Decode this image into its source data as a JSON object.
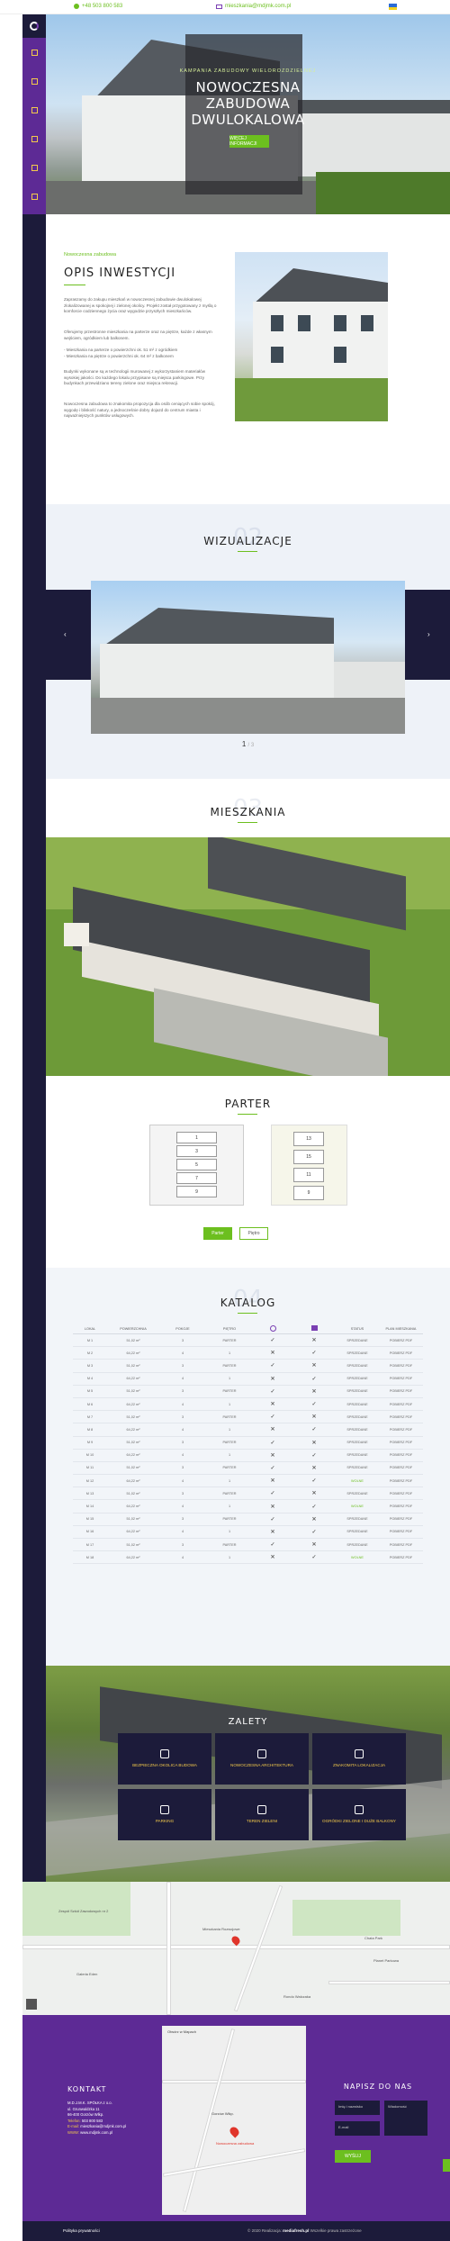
{
  "topbar": {
    "phone": "+48 503 800 583",
    "email": "mieszkania@mdjmk.com.pl",
    "phone_icon": "phone-icon",
    "email_icon": "envelope-icon",
    "language_flag": "ukraine-flag",
    "accent_color": "#6cbf1f"
  },
  "sidebar": {
    "logo": "logo",
    "items": [
      {
        "icon": "home-icon"
      },
      {
        "icon": "building-icon"
      },
      {
        "icon": "visualization-icon"
      },
      {
        "icon": "floorplan-icon"
      },
      {
        "icon": "catalog-icon"
      },
      {
        "icon": "location-icon"
      },
      {
        "icon": "contact-icon"
      }
    ],
    "bg_color": "#5d2a95",
    "rail_color": "#1c1b3a"
  },
  "hero": {
    "kicker": "KAMPANIA ZABUDOWY WIELOROZDZIELNEJ",
    "title": "NOWOCZESNA ZABUDOWA DWULOKALOWA",
    "button": "WIĘCEJ INFORMACJI"
  },
  "opis": {
    "kicker": "Nowoczesna zabudowa",
    "title": "OPIS INWESTYCJI",
    "paragraphs": [
      "Zapraszamy do zakupu mieszkań w nowoczesnej zabudowie dwulokalowej zlokalizowanej w spokojnej i zielonej okolicy. Projekt został przygotowany z myślą o komforcie codziennego życia oraz wygodzie przyszłych mieszkańców.",
      "Oferujemy przestronne mieszkania na parterze oraz na piętrze, każde z własnym wejściem, ogródkiem lub balkonem.",
      "- Mieszkania na parterze o powierzchni ok. 51 m² z ogródkiem\n- Mieszkania na piętrze o powierzchni ok. 64 m² z balkonem",
      "Budynki wykonane są w technologii murowanej z wykorzystaniem materiałów wysokiej jakości. Do każdego lokalu przypisane są miejsca parkingowe. Przy budynkach przewidziano tereny zielone oraz miejsca rekreacji.",
      "Nowoczesna zabudowa to znakomita propozycja dla osób ceniących sobie spokój, wygodę i bliskość natury, a jednocześnie dobry dojazd do centrum miasta i najważniejszych punktów usługowych."
    ]
  },
  "wizualizacje": {
    "bg_number": "02",
    "title": "WIZUALIZACJE",
    "prev": "‹",
    "next": "›",
    "page": "1",
    "page_sep": "/ 3"
  },
  "mieszkania": {
    "bg_number": "03",
    "title": "MIESZKANIA"
  },
  "parter": {
    "title": "PARTER",
    "units_left": [
      "1",
      "3",
      "5",
      "7",
      "9"
    ],
    "units_right": [
      "13",
      "15",
      "11",
      "9"
    ],
    "unit_a": "A",
    "unit_b": "B",
    "btn_parter": "Parter",
    "btn_pietro": "Piętro"
  },
  "katalog": {
    "bg_number": "04",
    "title": "KATALOG",
    "headers": [
      "LOKAL",
      "POWIERZCHNIA",
      "POKOJE",
      "PIĘTRO",
      "OGRÓD",
      "BALKON",
      "STATUS",
      "PLAN MIESZKANIA"
    ],
    "header_icons": [
      "garden-icon",
      "balcony-icon"
    ],
    "rows": [
      {
        "lokal": "M 1",
        "pow": "51,02 m²",
        "pokoje": "3",
        "pietro": "PARTER",
        "ogrod": true,
        "balkon": false,
        "status": "SPRZEDANE",
        "plan": "POBIERZ PDF"
      },
      {
        "lokal": "M 2",
        "pow": "64,22 m²",
        "pokoje": "4",
        "pietro": "1",
        "ogrod": false,
        "balkon": true,
        "status": "SPRZEDANE",
        "plan": "POBIERZ PDF"
      },
      {
        "lokal": "M 3",
        "pow": "51,02 m²",
        "pokoje": "3",
        "pietro": "PARTER",
        "ogrod": true,
        "balkon": false,
        "status": "SPRZEDANE",
        "plan": "POBIERZ PDF"
      },
      {
        "lokal": "M 4",
        "pow": "64,22 m²",
        "pokoje": "4",
        "pietro": "1",
        "ogrod": false,
        "balkon": true,
        "status": "SPRZEDANE",
        "plan": "POBIERZ PDF"
      },
      {
        "lokal": "M 5",
        "pow": "51,02 m²",
        "pokoje": "3",
        "pietro": "PARTER",
        "ogrod": true,
        "balkon": false,
        "status": "SPRZEDANE",
        "plan": "POBIERZ PDF"
      },
      {
        "lokal": "M 6",
        "pow": "64,22 m²",
        "pokoje": "4",
        "pietro": "1",
        "ogrod": false,
        "balkon": true,
        "status": "SPRZEDANE",
        "plan": "POBIERZ PDF"
      },
      {
        "lokal": "M 7",
        "pow": "51,02 m²",
        "pokoje": "3",
        "pietro": "PARTER",
        "ogrod": true,
        "balkon": false,
        "status": "SPRZEDANE",
        "plan": "POBIERZ PDF"
      },
      {
        "lokal": "M 8",
        "pow": "64,22 m²",
        "pokoje": "4",
        "pietro": "1",
        "ogrod": false,
        "balkon": true,
        "status": "SPRZEDANE",
        "plan": "POBIERZ PDF"
      },
      {
        "lokal": "M 9",
        "pow": "51,02 m²",
        "pokoje": "3",
        "pietro": "PARTER",
        "ogrod": true,
        "balkon": false,
        "status": "SPRZEDANE",
        "plan": "POBIERZ PDF"
      },
      {
        "lokal": "M 10",
        "pow": "64,22 m²",
        "pokoje": "4",
        "pietro": "1",
        "ogrod": false,
        "balkon": true,
        "status": "SPRZEDANE",
        "plan": "POBIERZ PDF"
      },
      {
        "lokal": "M 11",
        "pow": "51,02 m²",
        "pokoje": "3",
        "pietro": "PARTER",
        "ogrod": true,
        "balkon": false,
        "status": "SPRZEDANE",
        "plan": "POBIERZ PDF"
      },
      {
        "lokal": "M 12",
        "pow": "64,22 m²",
        "pokoje": "4",
        "pietro": "1",
        "ogrod": false,
        "balkon": true,
        "status": "WOLNE",
        "plan": "POBIERZ PDF"
      },
      {
        "lokal": "M 13",
        "pow": "51,02 m²",
        "pokoje": "3",
        "pietro": "PARTER",
        "ogrod": true,
        "balkon": false,
        "status": "SPRZEDANE",
        "plan": "POBIERZ PDF"
      },
      {
        "lokal": "M 14",
        "pow": "64,22 m²",
        "pokoje": "4",
        "pietro": "1",
        "ogrod": false,
        "balkon": true,
        "status": "WOLNE",
        "plan": "POBIERZ PDF"
      },
      {
        "lokal": "M 15",
        "pow": "51,02 m²",
        "pokoje": "3",
        "pietro": "PARTER",
        "ogrod": true,
        "balkon": false,
        "status": "SPRZEDANE",
        "plan": "POBIERZ PDF"
      },
      {
        "lokal": "M 16",
        "pow": "64,22 m²",
        "pokoje": "4",
        "pietro": "1",
        "ogrod": false,
        "balkon": true,
        "status": "SPRZEDANE",
        "plan": "POBIERZ PDF"
      },
      {
        "lokal": "M 17",
        "pow": "51,02 m²",
        "pokoje": "3",
        "pietro": "PARTER",
        "ogrod": true,
        "balkon": false,
        "status": "SPRZEDANE",
        "plan": "POBIERZ PDF"
      },
      {
        "lokal": "M 18",
        "pow": "64,22 m²",
        "pokoje": "4",
        "pietro": "1",
        "ogrod": false,
        "balkon": true,
        "status": "WOLNE",
        "plan": "POBIERZ PDF"
      }
    ]
  },
  "zalety": {
    "title": "ZALETY",
    "tiles": [
      {
        "icon": "family-icon",
        "label": "BEZPIECZNA OKOLICA BUDOWA"
      },
      {
        "icon": "architecture-icon",
        "label": "NOWOCZESNA ARCHITEKTURA"
      },
      {
        "icon": "parking-icon",
        "label": "ZNAKOMITA LOKALIZACJA"
      },
      {
        "icon": "wallet-icon",
        "label": "PARKING"
      },
      {
        "icon": "garden-icon",
        "label": "TEREN ZIELENI"
      },
      {
        "icon": "tree-icon",
        "label": "OGRÓDKI ZIELONE I DUŻE BALKONY"
      }
    ]
  },
  "map": {
    "labels": [
      "Zespół Szkół Zawodowych nr 2",
      "Mieszkania Rozwojowe",
      "Chata Park",
      "Galeria Eden",
      "Rondo Walczaka",
      "Planet Parkowa"
    ]
  },
  "kontakt": {
    "title": "KONTAKT",
    "lines": [
      {
        "label": "",
        "value": "M.D.J.M.K. SPÓŁKA z o.o."
      },
      {
        "label": "",
        "value": "ul. Grunwaldzka 11"
      },
      {
        "label": "",
        "value": "66-400 Gorzów Wlkp."
      },
      {
        "label": "Telefon:",
        "value": "503 800 583"
      },
      {
        "label": "E-mail:",
        "value": "mieszkania@mdjmk.com.pl"
      },
      {
        "label": "WWW:",
        "value": "www.mdjmk.com.pl"
      }
    ],
    "map_labels": [
      "Otwórz w Mapach",
      "Gorzów Wlkp.",
      "Nowoczesna zabudowa"
    ],
    "form_title": "NAPISZ DO NAS",
    "form": {
      "name_placeholder": "Imię i nazwisko",
      "email_placeholder": "E-mail",
      "message_placeholder": "Wiadomość",
      "send": "WYŚLIJ"
    }
  },
  "footer": {
    "left": "Polityka prywatności",
    "right_prefix": "© 2020 Realizacja:",
    "right_brand": "mediafresh.pl",
    "right_suffix": "Wszelkie prawa zastrzeżone"
  }
}
